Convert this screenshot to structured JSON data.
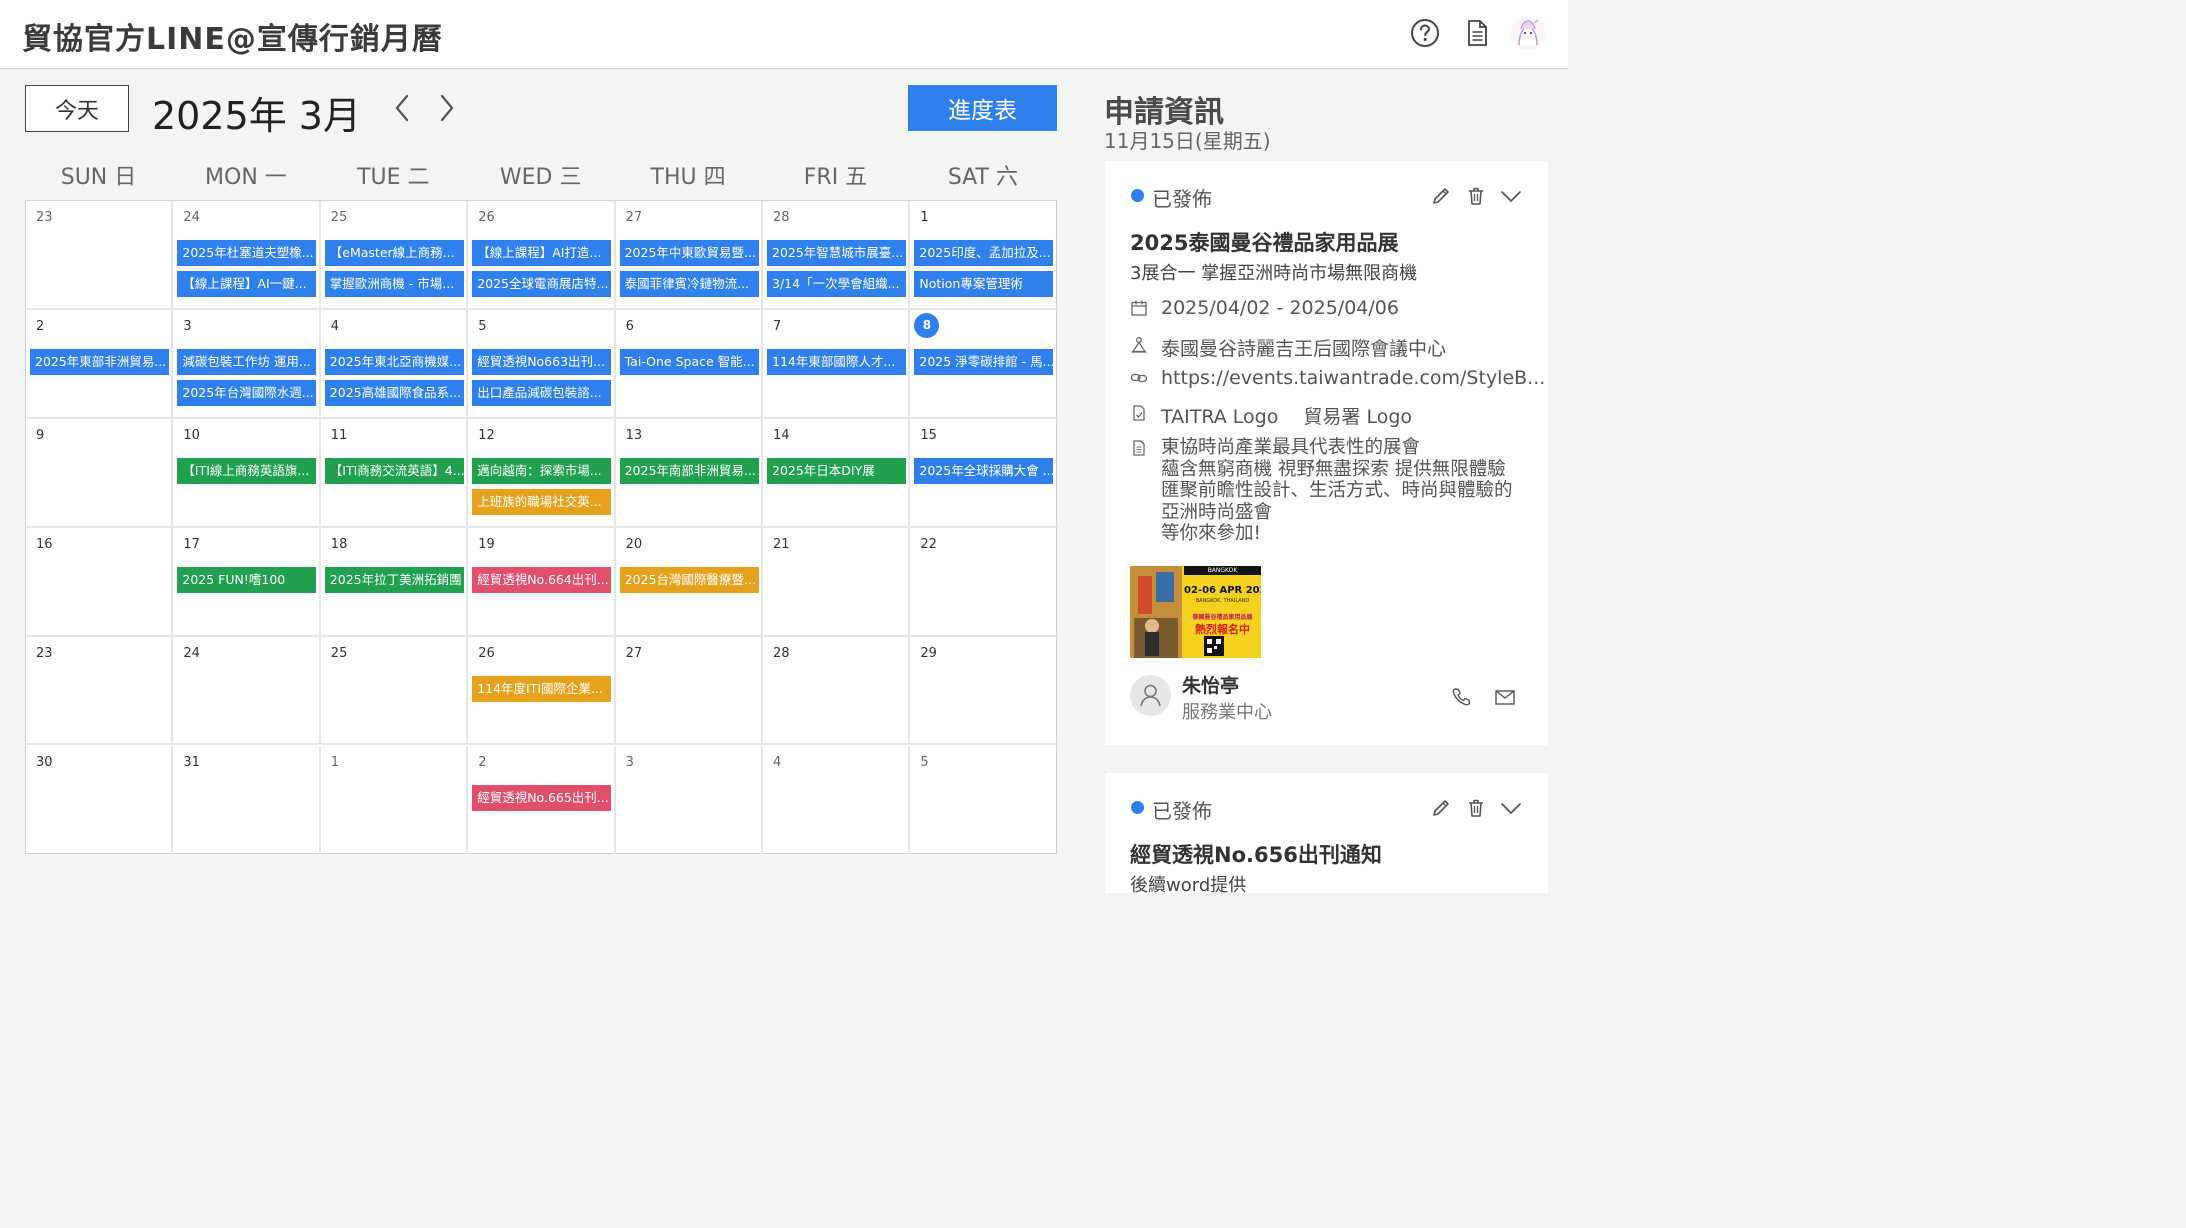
{
  "header": {
    "title": "貿協官方LINE@宣傳行銷月曆",
    "icons": [
      "help-icon",
      "document-icon",
      "user-avatar-icon"
    ]
  },
  "toolbar": {
    "today_label": "今天",
    "month_title": "2025年 3月",
    "progress_label": "進度表"
  },
  "weekdays": [
    "SUN 日",
    "MON 一",
    "TUE 二",
    "WED 三",
    "THU 四",
    "FRI 五",
    "SAT 六"
  ],
  "weeks": [
    [
      {
        "day": "23",
        "muted": true,
        "events": []
      },
      {
        "day": "24",
        "muted": true,
        "events": [
          {
            "text": "2025年杜塞道夫塑橡...",
            "color": "blue"
          },
          {
            "text": "【線上課程】AI一鍵...",
            "color": "blue"
          }
        ]
      },
      {
        "day": "25",
        "muted": true,
        "events": [
          {
            "text": "【eMaster線上商務...",
            "color": "blue"
          },
          {
            "text": "掌握歐洲商機 - 市場...",
            "color": "blue"
          }
        ]
      },
      {
        "day": "26",
        "muted": true,
        "events": [
          {
            "text": "【線上課程】AI打造...",
            "color": "blue"
          },
          {
            "text": "2025全球電商展店特...",
            "color": "blue"
          }
        ]
      },
      {
        "day": "27",
        "muted": true,
        "events": [
          {
            "text": "2025年中東歐貿易暨...",
            "color": "blue"
          },
          {
            "text": "泰國菲律賓冷鏈物流...",
            "color": "blue"
          }
        ]
      },
      {
        "day": "28",
        "muted": true,
        "events": [
          {
            "text": "2025年智慧城市展臺...",
            "color": "blue"
          },
          {
            "text": "3/14「一次學會組織...",
            "color": "blue"
          }
        ]
      },
      {
        "day": "1",
        "events": [
          {
            "text": "2025印度、孟加拉及...",
            "color": "blue"
          },
          {
            "text": "Notion專案管理術",
            "color": "blue"
          }
        ]
      }
    ],
    [
      {
        "day": "2",
        "events": [
          {
            "text": "2025年東部非洲貿易...",
            "color": "blue"
          }
        ]
      },
      {
        "day": "3",
        "events": [
          {
            "text": "減碳包裝工作坊 運用...",
            "color": "blue"
          },
          {
            "text": "2025年台灣國際水週...",
            "color": "blue"
          }
        ]
      },
      {
        "day": "4",
        "events": [
          {
            "text": "2025年東北亞商機媒...",
            "color": "blue"
          },
          {
            "text": "2025高雄國際食品系...",
            "color": "blue"
          }
        ]
      },
      {
        "day": "5",
        "events": [
          {
            "text": "經貿透視No663出刊...",
            "color": "blue"
          },
          {
            "text": "出口產品減碳包裝諮...",
            "color": "blue"
          }
        ]
      },
      {
        "day": "6",
        "events": [
          {
            "text": "Tai-One Space 智能...",
            "color": "blue"
          }
        ]
      },
      {
        "day": "7",
        "events": [
          {
            "text": "114年東部國際人才...",
            "color": "blue"
          }
        ]
      },
      {
        "day": "8",
        "today": true,
        "events": [
          {
            "text": "2025 淨零碳排館 - 馬...",
            "color": "blue"
          }
        ]
      }
    ],
    [
      {
        "day": "9",
        "events": []
      },
      {
        "day": "10",
        "events": [
          {
            "text": "【ITI線上商務英語旗...",
            "color": "green"
          }
        ]
      },
      {
        "day": "11",
        "events": [
          {
            "text": "【ITI商務交流英語】4...",
            "color": "green"
          }
        ]
      },
      {
        "day": "12",
        "events": [
          {
            "text": "邁向越南：探索市場...",
            "color": "green"
          },
          {
            "text": "上班族的職場社交英...",
            "color": "orange"
          }
        ]
      },
      {
        "day": "13",
        "events": [
          {
            "text": "2025年南部非洲貿易...",
            "color": "green"
          }
        ]
      },
      {
        "day": "14",
        "events": [
          {
            "text": "2025年日本DIY展",
            "color": "green"
          }
        ]
      },
      {
        "day": "15",
        "events": [
          {
            "text": "2025年全球採購大會 ...",
            "color": "blue"
          }
        ]
      }
    ],
    [
      {
        "day": "16",
        "events": []
      },
      {
        "day": "17",
        "events": [
          {
            "text": "2025 FUN!嗜100",
            "color": "green"
          }
        ]
      },
      {
        "day": "18",
        "events": [
          {
            "text": "2025年拉丁美洲拓銷團",
            "color": "green"
          }
        ]
      },
      {
        "day": "19",
        "events": [
          {
            "text": "經貿透視No.664出刊...",
            "color": "red"
          }
        ]
      },
      {
        "day": "20",
        "events": [
          {
            "text": "2025台灣國際醫療暨...",
            "color": "orange"
          }
        ]
      },
      {
        "day": "21",
        "events": []
      },
      {
        "day": "22",
        "events": []
      }
    ],
    [
      {
        "day": "23",
        "events": []
      },
      {
        "day": "24",
        "events": []
      },
      {
        "day": "25",
        "events": []
      },
      {
        "day": "26",
        "events": [
          {
            "text": "114年度ITI國際企業...",
            "color": "orange"
          }
        ]
      },
      {
        "day": "27",
        "events": []
      },
      {
        "day": "28",
        "events": []
      },
      {
        "day": "29",
        "events": []
      }
    ],
    [
      {
        "day": "30",
        "events": []
      },
      {
        "day": "31",
        "events": []
      },
      {
        "day": "1",
        "muted": true,
        "events": []
      },
      {
        "day": "2",
        "muted": true,
        "events": [
          {
            "text": "經貿透視No.665出刊...",
            "color": "red"
          }
        ]
      },
      {
        "day": "3",
        "muted": true,
        "events": []
      },
      {
        "day": "4",
        "muted": true,
        "events": []
      },
      {
        "day": "5",
        "muted": true,
        "events": []
      }
    ]
  ],
  "side": {
    "title": "申請資訊",
    "date": "11月15日(星期五)",
    "cards": [
      {
        "status": "已發佈",
        "title": "2025泰國曼谷禮品家用品展",
        "subtitle": "3展合一 掌握亞洲時尚市場無限商機",
        "date_range": "2025/04/02 - 2025/04/06",
        "venue": "泰國曼谷詩麗吉王后國際會議中心",
        "link": "https://events.taiwantrade.com/StyleB...",
        "logos": "TAITRA Logo　 貿易署 Logo",
        "description": [
          "東協時尚產業最具代表性的展會",
          "蘊含無窮商機 視野無盡探索 提供無限體驗",
          "匯聚前瞻性設計、生活方式、時尚與體驗的",
          "亞洲時尚盛會",
          "等你來參加!"
        ],
        "poster": {
          "line1": "BANGKOK",
          "line2": "02-06 APR 2025",
          "line3": "BANGKOK, THAILAND",
          "line4": "泰國曼谷禮品家用品展",
          "line5": "熱烈報名中"
        },
        "contact_name": "朱怡亭",
        "contact_dept": "服務業中心"
      },
      {
        "status": "已發佈",
        "title": "經貿透視No.656出刊通知",
        "subtitle": "後續word提供"
      }
    ]
  },
  "colors": {
    "blue": "#2f80ed",
    "green": "#21a04f",
    "orange": "#e6a11d",
    "red": "#e0506a"
  }
}
